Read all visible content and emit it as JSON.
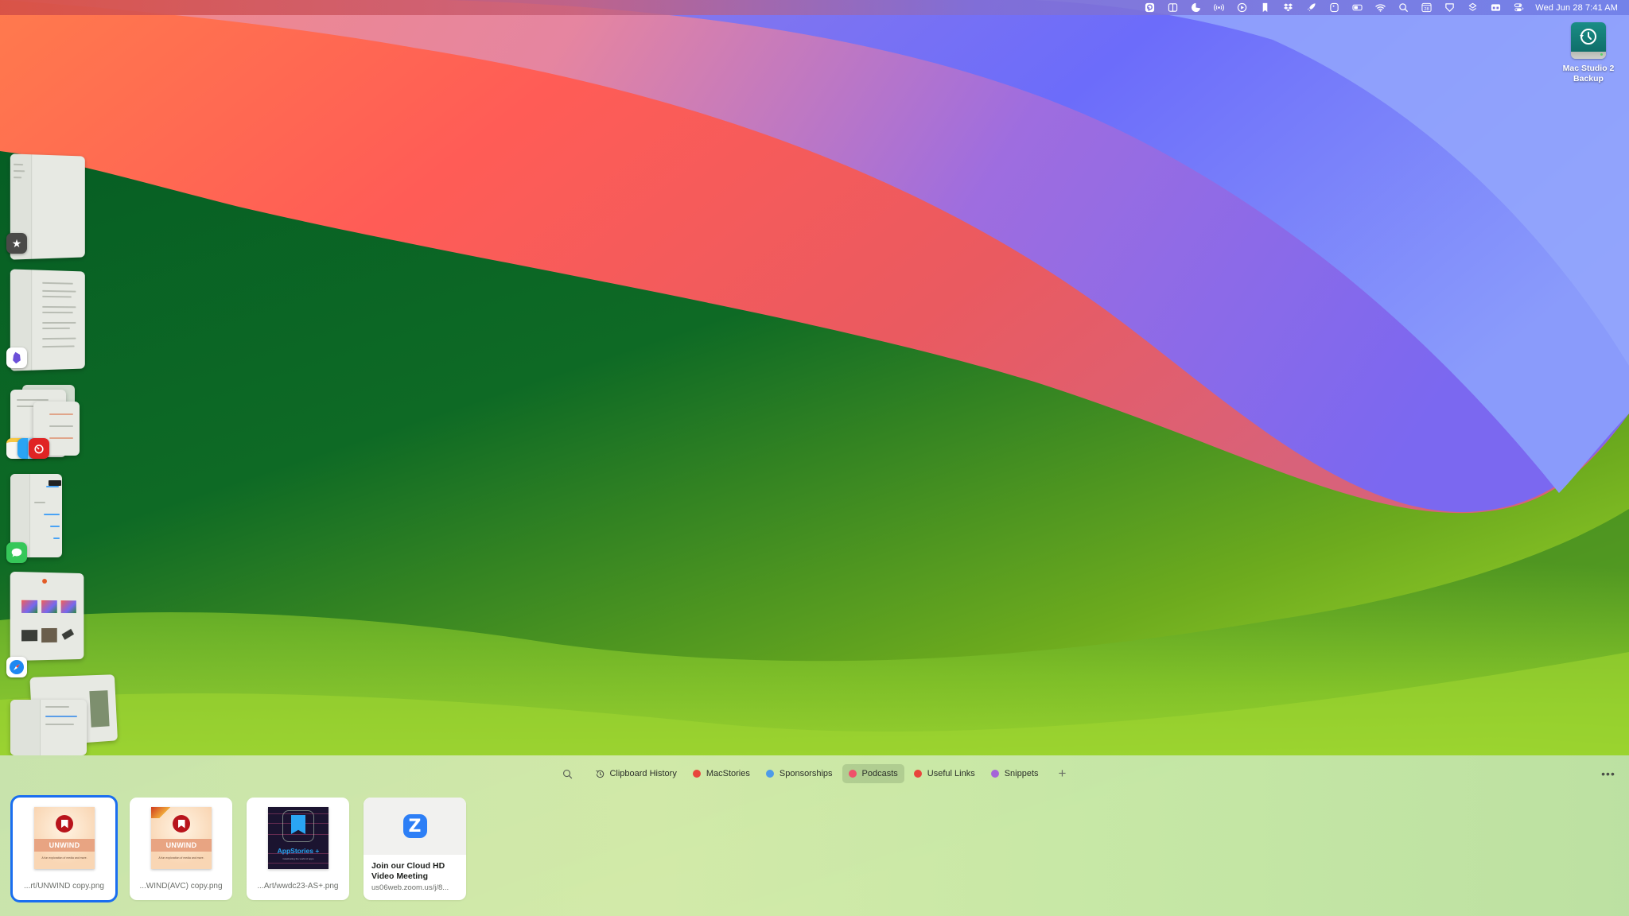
{
  "menubar": {
    "status_icons": [
      "pastebot-icon",
      "split-view-icon",
      "pac-icon",
      "broadcast-icon",
      "play-circle-icon",
      "bookmark-icon",
      "dropbox-icon",
      "rocket-icon",
      "timer-icon",
      "battery-toggle-icon",
      "wifi-icon",
      "spotlight-search-icon",
      "calendar-icon",
      "shortcut-icon",
      "stack-icon",
      "screen-icon",
      "control-center-icon"
    ],
    "calendar_day": "28",
    "clock": "Wed Jun 28  7:41 AM"
  },
  "desktop": {
    "icons": [
      {
        "label_line1": "Mac Studio 2",
        "label_line2": "Backup",
        "icon": "time-machine-drive-icon"
      }
    ]
  },
  "stage_manager": {
    "groups": [
      {
        "app": "reeder-icon",
        "badge_color": "#4a4a48"
      },
      {
        "app": "obsidian-icon",
        "badge_color": "#6b4fd8"
      },
      {
        "app": "notes-finder-timery-icon",
        "badge_color": "#e02424"
      },
      {
        "app": "messages-icon",
        "badge_color": "#35c759"
      },
      {
        "app": "safari-icon",
        "badge_color": "#1e88f2"
      },
      {
        "app": "mail-icon",
        "badge_color": "#3a8ef6"
      }
    ]
  },
  "clipboard": {
    "search_icon": "search-icon",
    "tabs": [
      {
        "label": "Clipboard History",
        "icon": "history-icon",
        "color": null,
        "active": false
      },
      {
        "label": "MacStories",
        "color": "#e8453c",
        "active": false
      },
      {
        "label": "Sponsorships",
        "color": "#4d9be8",
        "active": false
      },
      {
        "label": "Podcasts",
        "color": "#f0506a",
        "active": true
      },
      {
        "label": "Useful Links",
        "color": "#e8453c",
        "active": false
      },
      {
        "label": "Snippets",
        "color": "#a565d9",
        "active": false
      }
    ],
    "add_label": "+",
    "more_label": "•••",
    "items": [
      {
        "type": "image",
        "caption": "...rt/UNWIND copy.png",
        "art_title": "UNWIND",
        "art_tagline": "A fun exploration of media and more.",
        "selected": true
      },
      {
        "type": "image",
        "caption": "...WIND(AVC) copy.png",
        "art_title": "UNWIND",
        "art_tagline": "A fun exploration of media and more.",
        "selected": false
      },
      {
        "type": "image",
        "caption": "...Art/wwdc23-AS+.png",
        "art_title": "AppStories +",
        "art_tagline": "Celebrating the world of apps",
        "selected": false
      },
      {
        "type": "link",
        "title": "Join our Cloud HD Video Meeting",
        "url": "us06web.zoom.us/j/8...",
        "logo": "Z",
        "selected": false
      }
    ]
  }
}
